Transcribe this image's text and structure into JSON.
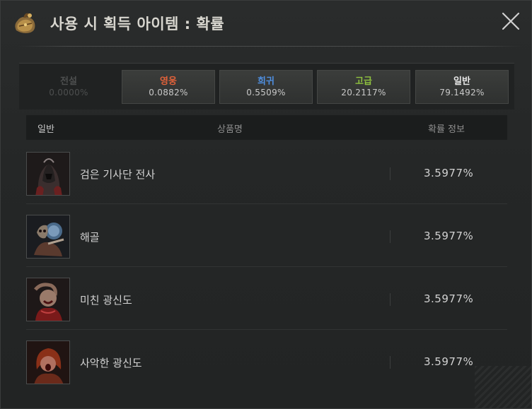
{
  "window": {
    "title": "사용 시 획득 아이템 : 확률"
  },
  "tabs": [
    {
      "name": "전설",
      "pct": "0.0000%",
      "color": "#4d4f4f",
      "state": "disabled"
    },
    {
      "name": "영웅",
      "pct": "0.0882%",
      "color": "#e0613a",
      "state": "normal"
    },
    {
      "name": "희귀",
      "pct": "0.5509%",
      "color": "#4f8fe0",
      "state": "normal"
    },
    {
      "name": "고급",
      "pct": "20.2117%",
      "color": "#8fc23f",
      "state": "normal"
    },
    {
      "name": "일반",
      "pct": "79.1492%",
      "color": "#e8e8e8",
      "state": "selected"
    }
  ],
  "table": {
    "category": "일반",
    "col_name": "상품명",
    "col_prob": "확률 정보",
    "rows": [
      {
        "name": "검은 기사단 전사",
        "prob": "3.5977%",
        "icon": "black-knight-warrior-portrait"
      },
      {
        "name": "해골",
        "prob": "3.5977%",
        "icon": "skeleton-portrait"
      },
      {
        "name": "미친 광신도",
        "prob": "3.5977%",
        "icon": "mad-cultist-portrait"
      },
      {
        "name": "사악한 광신도",
        "prob": "3.5977%",
        "icon": "evil-cultist-portrait"
      }
    ]
  }
}
